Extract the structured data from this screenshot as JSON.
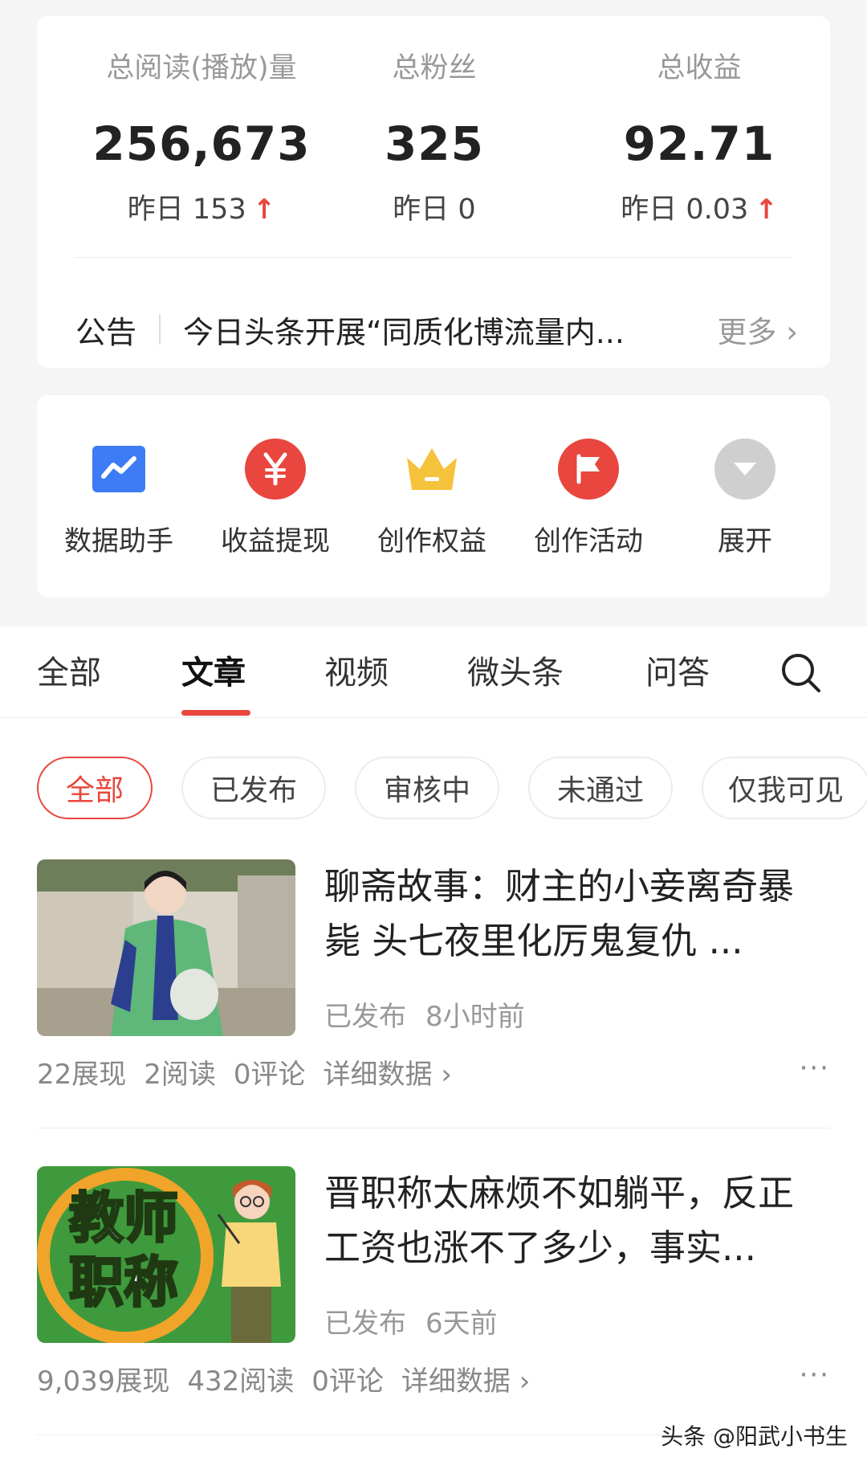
{
  "stats": [
    {
      "label": "总阅读(播放)量",
      "value": "256,673",
      "yesterday": "昨日 153",
      "trend_up": true
    },
    {
      "label": "总粉丝",
      "value": "325",
      "yesterday": "昨日 0",
      "trend_up": false
    },
    {
      "label": "总收益",
      "value": "92.71",
      "yesterday": "昨日 0.03",
      "trend_up": true
    }
  ],
  "notice": {
    "label": "公告",
    "text": "今日头条开展“同质化博流量内...",
    "more": "更多 ›"
  },
  "tools": [
    {
      "label": "数据助手",
      "icon": "chart-trend-icon",
      "color": "#3d7cf5"
    },
    {
      "label": "收益提现",
      "icon": "yuan-icon",
      "color": "#e8463e"
    },
    {
      "label": "创作权益",
      "icon": "crown-icon",
      "color": "#f5c23c"
    },
    {
      "label": "创作活动",
      "icon": "flag-icon",
      "color": "#e8463e"
    },
    {
      "label": "展开",
      "icon": "expand-icon",
      "color": "#cfcfcf"
    }
  ],
  "tabs": [
    "全部",
    "文章",
    "视频",
    "微头条",
    "问答"
  ],
  "active_tab": "文章",
  "filters": [
    "全部",
    "已发布",
    "审核中",
    "未通过",
    "仅我可见"
  ],
  "active_filter": "全部",
  "articles": [
    {
      "title": "聊斋故事：财主的小妾离奇暴毙 头七夜里化厉鬼复仇 ...",
      "status": "已发布",
      "time": "8小时前",
      "impressions": "22展现",
      "reads": "2阅读",
      "comments": "0评论",
      "details": "详细数据 ›",
      "more": "···"
    },
    {
      "title": "晋职称太麻烦不如躺平，反正工资也涨不了多少，事实...",
      "status": "已发布",
      "time": "6天前",
      "impressions": "9,039展现",
      "reads": "432阅读",
      "comments": "0评论",
      "details": "详细数据 ›",
      "more": "···",
      "thumb_text_1": "教师",
      "thumb_text_2": "职称"
    }
  ],
  "watermark": "头条 @阳武小书生"
}
